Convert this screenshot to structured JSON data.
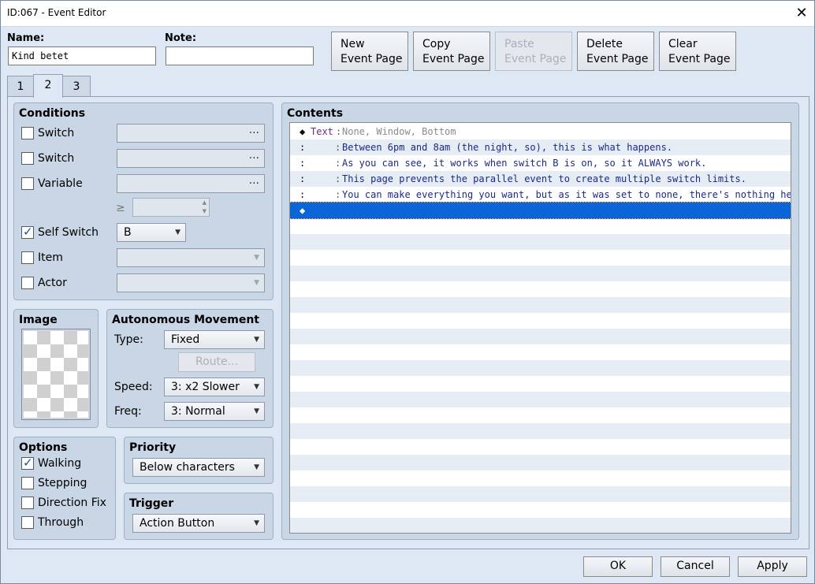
{
  "window": {
    "title": "ID:067 - Event Editor"
  },
  "name": {
    "label": "Name:",
    "value": "Kind betet"
  },
  "note": {
    "label": "Note:",
    "value": ""
  },
  "page_buttons": [
    {
      "line1": "New",
      "line2": "Event Page"
    },
    {
      "line1": "Copy",
      "line2": "Event Page"
    },
    {
      "line1": "Paste",
      "line2": "Event Page"
    },
    {
      "line1": "Delete",
      "line2": "Event Page"
    },
    {
      "line1": "Clear",
      "line2": "Event Page"
    }
  ],
  "tabs": [
    "1",
    "2",
    "3"
  ],
  "conditions": {
    "title": "Conditions",
    "switch1": {
      "label": "Switch",
      "dots": "..."
    },
    "switch2": {
      "label": "Switch",
      "dots": "..."
    },
    "variable": {
      "label": "Variable",
      "dots": "...",
      "ge": "≥"
    },
    "self_switch": {
      "label": "Self Switch",
      "value": "B"
    },
    "item": {
      "label": "Item"
    },
    "actor": {
      "label": "Actor"
    }
  },
  "image": {
    "title": "Image"
  },
  "movement": {
    "title": "Autonomous Movement",
    "type_label": "Type:",
    "type_value": "Fixed",
    "route_label": "Route...",
    "speed_label": "Speed:",
    "speed_value": "3: x2 Slower",
    "freq_label": "Freq:",
    "freq_value": "3: Normal"
  },
  "options": {
    "title": "Options",
    "walking": "Walking",
    "stepping": "Stepping",
    "direction_fix": "Direction Fix",
    "through": "Through"
  },
  "priority": {
    "title": "Priority",
    "value": "Below characters"
  },
  "trigger": {
    "title": "Trigger",
    "value": "Action Button"
  },
  "contents": {
    "title": "Contents",
    "rows": [
      {
        "mark": "◆",
        "cmd": "Text",
        "colon": ":",
        "arg": "None, Window, Bottom"
      },
      {
        "mark": ":",
        "cmd": "",
        "colon": ":",
        "arg": "Between 6pm and 8am (the night, so), this is what happens."
      },
      {
        "mark": ":",
        "cmd": "",
        "colon": ":",
        "arg": "As you can see, it works when switch B is on, so it ALWAYS work."
      },
      {
        "mark": ":",
        "cmd": "",
        "colon": ":",
        "arg": "This page prevents the parallel event to create multiple switch limits."
      },
      {
        "mark": ":",
        "cmd": "",
        "colon": ":",
        "arg": "You can make everything you want, but as it was set to none, there's nothing here."
      },
      {
        "mark": "◆",
        "cmd": "",
        "colon": "",
        "arg": ""
      }
    ]
  },
  "footer": {
    "ok": "OK",
    "cancel": "Cancel",
    "apply": "Apply"
  }
}
